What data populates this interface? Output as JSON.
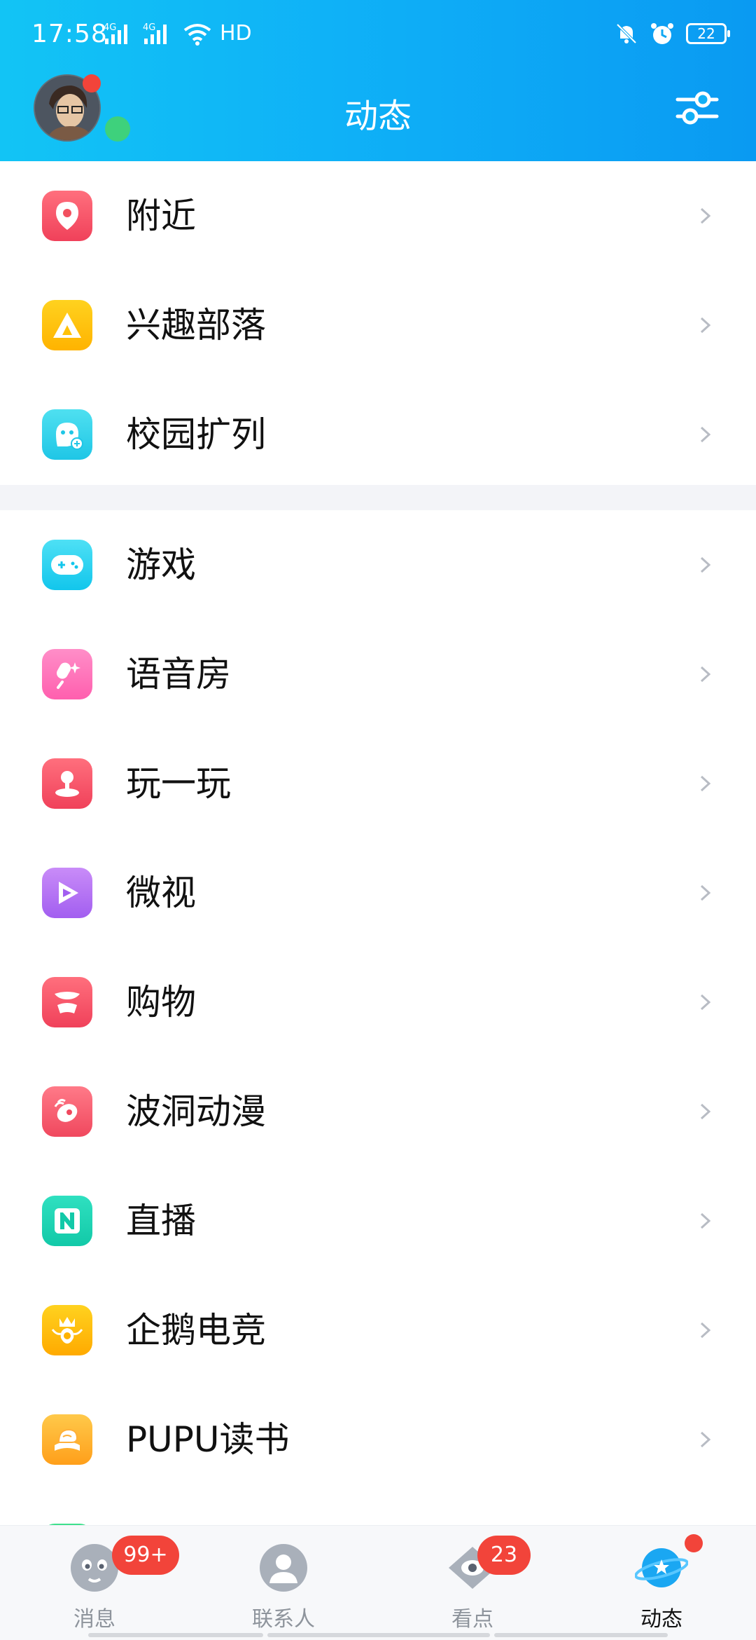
{
  "status_bar": {
    "time": "17:58",
    "network_1": "4G",
    "network_2": "4G",
    "hd_label": "HD",
    "battery": "22"
  },
  "header": {
    "title": "动态"
  },
  "colors": {
    "header_start": "#12c4f5",
    "header_end": "#0a9af2",
    "badge_red": "#f2443a",
    "online_green": "#3ed17c"
  },
  "sections": [
    {
      "items": [
        {
          "label": "附近",
          "icon": "location-pin-icon"
        },
        {
          "label": "兴趣部落",
          "icon": "tent-icon"
        },
        {
          "label": "校园扩列",
          "icon": "campus-friend-icon"
        }
      ]
    },
    {
      "items": [
        {
          "label": "游戏",
          "icon": "gamepad-icon"
        },
        {
          "label": "语音房",
          "icon": "microphone-icon"
        },
        {
          "label": "玩一玩",
          "icon": "joystick-icon"
        },
        {
          "label": "微视",
          "icon": "play-icon"
        },
        {
          "label": "购物",
          "icon": "shopping-icon"
        },
        {
          "label": "波洞动漫",
          "icon": "anime-icon"
        },
        {
          "label": "直播",
          "icon": "live-icon"
        },
        {
          "label": "企鹅电竞",
          "icon": "esports-icon"
        },
        {
          "label": "PUPU读书",
          "icon": "book-icon"
        }
      ]
    }
  ],
  "tabbar": {
    "tabs": [
      {
        "label": "消息",
        "icon": "message-icon",
        "badge": "99+"
      },
      {
        "label": "联系人",
        "icon": "contacts-icon",
        "badge": ""
      },
      {
        "label": "看点",
        "icon": "eye-icon",
        "badge": "23"
      },
      {
        "label": "动态",
        "icon": "planet-icon",
        "badge": ""
      }
    ]
  }
}
